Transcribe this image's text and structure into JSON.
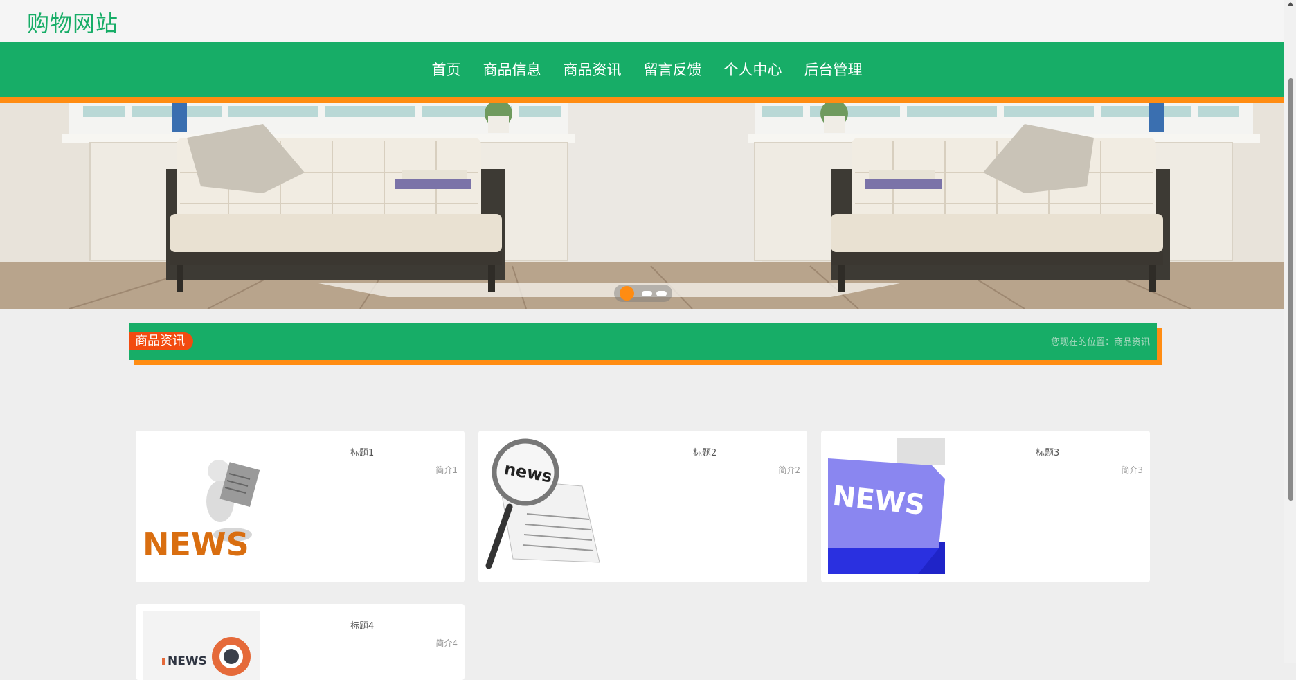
{
  "header": {
    "site_title": "购物网站"
  },
  "nav": {
    "items": [
      {
        "label": "首页"
      },
      {
        "label": "商品信息"
      },
      {
        "label": "商品资讯"
      },
      {
        "label": "留言反馈"
      },
      {
        "label": "个人中心"
      },
      {
        "label": "后台管理"
      }
    ]
  },
  "banner": {
    "slide_count": 3,
    "active_slide": 1
  },
  "section": {
    "title": "商品资讯",
    "breadcrumb": "您现在的位置：商品资讯"
  },
  "news": [
    {
      "title": "标题1",
      "intro": "简介1",
      "image_text": "NEWS"
    },
    {
      "title": "标题2",
      "intro": "简介2",
      "image_text": "news"
    },
    {
      "title": "标题3",
      "intro": "简介3",
      "image_text": "NEWS"
    },
    {
      "title": "标题4",
      "intro": "简介4",
      "image_text": "NEWS"
    }
  ],
  "colors": {
    "brand_green": "#17ad67",
    "accent_orange": "#ff8c12",
    "badge_red": "#f24b10"
  }
}
